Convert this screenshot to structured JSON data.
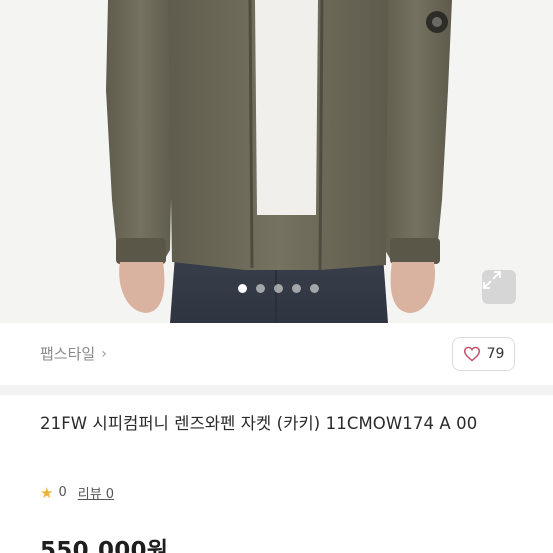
{
  "hero": {
    "image": "khaki-jacket-product-photo",
    "slide_count": 5,
    "active_slide": 0,
    "expand_icon": "expand-icon"
  },
  "seller": {
    "name": "팹스타일",
    "chevron": "›"
  },
  "like": {
    "icon": "heart-icon",
    "count": "79"
  },
  "product": {
    "title": "21FW 시피컴퍼니 렌즈와펜 자켓 (카키) 11CMOW174 A 00",
    "rating_icon": "star-icon",
    "rating": "0",
    "review_label": "리뷰 0",
    "price": "550,000원"
  },
  "colors": {
    "star": "#f0b33a",
    "jacket": "#6f6b5b"
  }
}
